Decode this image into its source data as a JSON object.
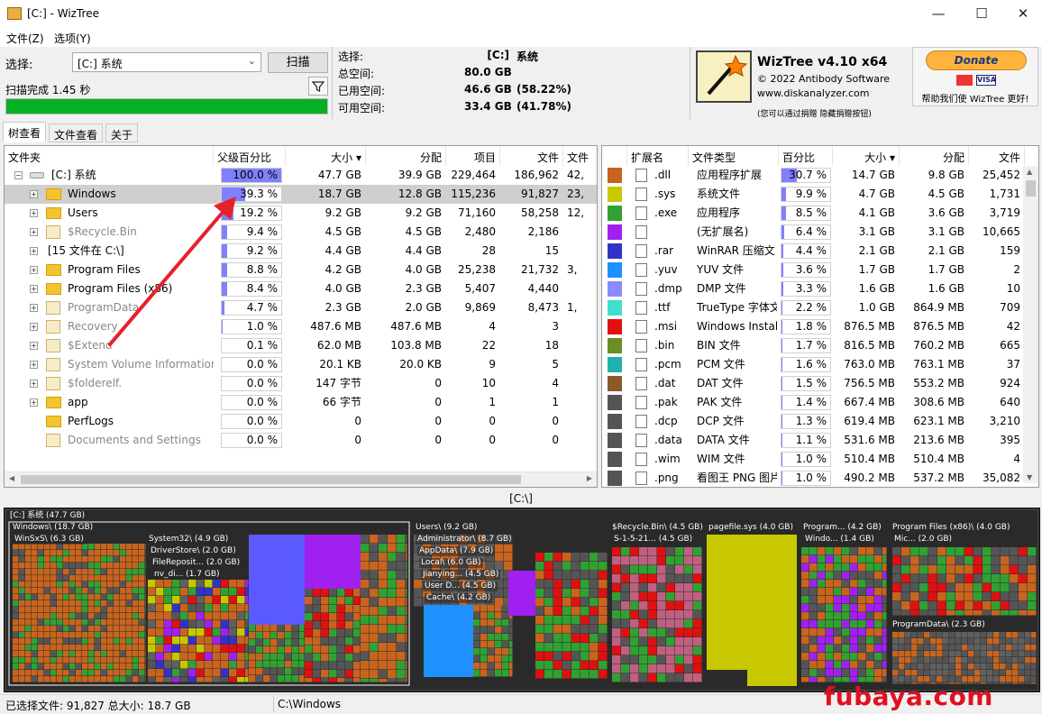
{
  "window": {
    "title": "[C:]  - WizTree",
    "minimize": "—",
    "maximize": "☐",
    "close": "✕"
  },
  "menu": [
    {
      "label": "文件(Z)"
    },
    {
      "label": "选项(Y)"
    }
  ],
  "scan": {
    "select_label": "选择:",
    "drive": "[C:] 系统",
    "scan_button": "扫描",
    "status": "扫描完成 1.45 秒",
    "progress": 1.0
  },
  "info": {
    "rows": [
      {
        "label": "选择:",
        "value": "[C:]",
        "value2": "系统"
      },
      {
        "label": "总空间:",
        "value": "80.0 GB",
        "value2": ""
      },
      {
        "label": "已用空间:",
        "value": "46.6 GB",
        "value2": "(58.22%)"
      },
      {
        "label": "可用空间:",
        "value": "33.4 GB",
        "value2": "(41.78%)"
      }
    ]
  },
  "brand": {
    "name": "WizTree v4.10 x64",
    "copyright": "© 2022 Antibody Software",
    "site": "www.diskanalyzer.com",
    "note": "(您可以通过捐赠 隐藏捐赠按钮)"
  },
  "donate": {
    "button": "Donate",
    "caption": "帮助我们使 WizTree 更好!"
  },
  "tabs": [
    {
      "label": "树查看"
    },
    {
      "label": "文件查看"
    },
    {
      "label": "关于"
    }
  ],
  "tree": {
    "headers": [
      "文件夹",
      "父级百分比",
      "大小 ▾",
      "分配",
      "项目",
      "文件",
      "文件"
    ],
    "rows": [
      {
        "name": "[C:] 系统",
        "pct": "100.0 %",
        "pctv": 1.0,
        "size": "47.7 GB",
        "alloc": "39.9 GB",
        "items": "229,464",
        "files": "186,962",
        "more": "42,",
        "kind": "drive",
        "indent": 0
      },
      {
        "name": "Windows",
        "pct": "39.3 %",
        "pctv": 0.393,
        "size": "18.7 GB",
        "alloc": "12.8 GB",
        "items": "115,236",
        "files": "91,827",
        "more": "23,",
        "kind": "folder",
        "indent": 1,
        "selected": true
      },
      {
        "name": "Users",
        "pct": "19.2 %",
        "pctv": 0.192,
        "size": "9.2 GB",
        "alloc": "9.2 GB",
        "items": "71,160",
        "files": "58,258",
        "more": "12,",
        "kind": "folder",
        "indent": 1
      },
      {
        "name": "$Recycle.Bin",
        "pct": "9.4 %",
        "pctv": 0.094,
        "size": "4.5 GB",
        "alloc": "4.5 GB",
        "items": "2,480",
        "files": "2,186",
        "more": "",
        "kind": "sys",
        "indent": 1
      },
      {
        "name": "[15 文件在 C:\\]",
        "pct": "9.2 %",
        "pctv": 0.092,
        "size": "4.4 GB",
        "alloc": "4.4 GB",
        "items": "28",
        "files": "15",
        "more": "",
        "kind": "none",
        "indent": 1
      },
      {
        "name": "Program Files",
        "pct": "8.8 %",
        "pctv": 0.088,
        "size": "4.2 GB",
        "alloc": "4.0 GB",
        "items": "25,238",
        "files": "21,732",
        "more": "3,",
        "kind": "folder",
        "indent": 1
      },
      {
        "name": "Program Files (x86)",
        "pct": "8.4 %",
        "pctv": 0.084,
        "size": "4.0 GB",
        "alloc": "2.3 GB",
        "items": "5,407",
        "files": "4,440",
        "more": "",
        "kind": "folder",
        "indent": 1
      },
      {
        "name": "ProgramData",
        "pct": "4.7 %",
        "pctv": 0.047,
        "size": "2.3 GB",
        "alloc": "2.0 GB",
        "items": "9,869",
        "files": "8,473",
        "more": "1,",
        "kind": "hidden",
        "indent": 1
      },
      {
        "name": "Recovery",
        "pct": "1.0 %",
        "pctv": 0.01,
        "size": "487.6 MB",
        "alloc": "487.6 MB",
        "items": "4",
        "files": "3",
        "more": "",
        "kind": "sys",
        "indent": 1
      },
      {
        "name": "$Extend",
        "pct": "0.1 %",
        "pctv": 0.001,
        "size": "62.0 MB",
        "alloc": "103.8 MB",
        "items": "22",
        "files": "18",
        "more": "",
        "kind": "sys",
        "indent": 1
      },
      {
        "name": "System Volume Information",
        "pct": "0.0 %",
        "pctv": 0.0,
        "size": "20.1 KB",
        "alloc": "20.0 KB",
        "items": "9",
        "files": "5",
        "more": "",
        "kind": "sys",
        "indent": 1
      },
      {
        "name": "$folderelf.",
        "pct": "0.0 %",
        "pctv": 0.0,
        "size": "147 字节",
        "alloc": "0",
        "items": "10",
        "files": "4",
        "more": "",
        "kind": "sys",
        "indent": 1
      },
      {
        "name": "app",
        "pct": "0.0 %",
        "pctv": 0.0,
        "size": "66 字节",
        "alloc": "0",
        "items": "1",
        "files": "1",
        "more": "",
        "kind": "folder",
        "indent": 1
      },
      {
        "name": "PerfLogs",
        "pct": "0.0 %",
        "pctv": 0.0,
        "size": "0",
        "alloc": "0",
        "items": "0",
        "files": "0",
        "more": "",
        "kind": "folder",
        "indent": 1
      },
      {
        "name": "Documents and Settings",
        "pct": "0.0 %",
        "pctv": 0.0,
        "size": "0",
        "alloc": "0",
        "items": "0",
        "files": "0",
        "more": "",
        "kind": "sys",
        "indent": 1
      }
    ]
  },
  "ext": {
    "headers": [
      "扩展名",
      "文件类型",
      "百分比",
      "大小 ▾",
      "分配",
      "文件"
    ],
    "rows": [
      {
        "color": "#c8641e",
        "ext": ".dll",
        "type": "应用程序扩展",
        "pct": "30.7 %",
        "pctv": 0.307,
        "size": "14.7 GB",
        "alloc": "9.8 GB",
        "files": "25,452"
      },
      {
        "color": "#c8c800",
        "ext": ".sys",
        "type": "系统文件",
        "pct": "9.9 %",
        "pctv": 0.099,
        "size": "4.7 GB",
        "alloc": "4.5 GB",
        "files": "1,731"
      },
      {
        "color": "#32a032",
        "ext": ".exe",
        "type": "应用程序",
        "pct": "8.5 %",
        "pctv": 0.085,
        "size": "4.1 GB",
        "alloc": "3.6 GB",
        "files": "3,719"
      },
      {
        "color": "#a020f0",
        "ext": "",
        "type": "(无扩展名)",
        "pct": "6.4 %",
        "pctv": 0.064,
        "size": "3.1 GB",
        "alloc": "3.1 GB",
        "files": "10,665"
      },
      {
        "color": "#3232c8",
        "ext": ".rar",
        "type": "WinRAR 压缩文",
        "pct": "4.4 %",
        "pctv": 0.044,
        "size": "2.1 GB",
        "alloc": "2.1 GB",
        "files": "159"
      },
      {
        "color": "#1e90ff",
        "ext": ".yuv",
        "type": "YUV 文件",
        "pct": "3.6 %",
        "pctv": 0.036,
        "size": "1.7 GB",
        "alloc": "1.7 GB",
        "files": "2"
      },
      {
        "color": "#8a8aff",
        "ext": ".dmp",
        "type": "DMP 文件",
        "pct": "3.3 %",
        "pctv": 0.033,
        "size": "1.6 GB",
        "alloc": "1.6 GB",
        "files": "10"
      },
      {
        "color": "#40e0d0",
        "ext": ".ttf",
        "type": "TrueType 字体文",
        "pct": "2.2 %",
        "pctv": 0.022,
        "size": "1.0 GB",
        "alloc": "864.9 MB",
        "files": "709"
      },
      {
        "color": "#e01010",
        "ext": ".msi",
        "type": "Windows Installe",
        "pct": "1.8 %",
        "pctv": 0.018,
        "size": "876.5 MB",
        "alloc": "876.5 MB",
        "files": "42"
      },
      {
        "color": "#6b8e23",
        "ext": ".bin",
        "type": "BIN 文件",
        "pct": "1.7 %",
        "pctv": 0.017,
        "size": "816.5 MB",
        "alloc": "760.2 MB",
        "files": "665"
      },
      {
        "color": "#20b2aa",
        "ext": ".pcm",
        "type": "PCM 文件",
        "pct": "1.6 %",
        "pctv": 0.016,
        "size": "763.0 MB",
        "alloc": "763.1 MB",
        "files": "37"
      },
      {
        "color": "#8b5a2b",
        "ext": ".dat",
        "type": "DAT 文件",
        "pct": "1.5 %",
        "pctv": 0.015,
        "size": "756.5 MB",
        "alloc": "553.2 MB",
        "files": "924"
      },
      {
        "color": "#555555",
        "ext": ".pak",
        "type": "PAK 文件",
        "pct": "1.4 %",
        "pctv": 0.014,
        "size": "667.4 MB",
        "alloc": "308.6 MB",
        "files": "640"
      },
      {
        "color": "#555555",
        "ext": ".dcp",
        "type": "DCP 文件",
        "pct": "1.3 %",
        "pctv": 0.013,
        "size": "619.4 MB",
        "alloc": "623.1 MB",
        "files": "3,210"
      },
      {
        "color": "#555555",
        "ext": ".data",
        "type": "DATA 文件",
        "pct": "1.1 %",
        "pctv": 0.011,
        "size": "531.6 MB",
        "alloc": "213.6 MB",
        "files": "395"
      },
      {
        "color": "#555555",
        "ext": ".wim",
        "type": "WIM 文件",
        "pct": "1.0 %",
        "pctv": 0.01,
        "size": "510.4 MB",
        "alloc": "510.4 MB",
        "files": "4"
      },
      {
        "color": "#555555",
        "ext": ".png",
        "type": "看图王 PNG 图片",
        "pct": "1.0 %",
        "pctv": 0.01,
        "size": "490.2 MB",
        "alloc": "537.2 MB",
        "files": "35,082"
      }
    ]
  },
  "treemap": {
    "path": "[C:\\]",
    "labels": {
      "root": "[C:] 系统 (47.7 GB)",
      "windows": "Windows\\ (18.7 GB)",
      "winsxs": "WinSxS\\ (6.3 GB)",
      "system32": "System32\\ (4.9 GB)",
      "driverstore": "DriverStore\\ (2.0 GB)",
      "filerepo": "FileReposit... (2.0 GB)",
      "nvdi": "nv_di... (1.7 GB)",
      "users": "Users\\ (9.2 GB)",
      "admin": "Administrator\\ (8.7 GB)",
      "appdata": "AppData\\ (7.9 GB)",
      "local": "Local\\ (6.0 GB)",
      "jianying": "Jianying... (4.5 GB)",
      "userd": "User D... (4.5 GB)",
      "cache": "Cache\\ (4.2 GB)",
      "recycle": "$Recycle.Bin\\ (4.5 GB)",
      "s15": "S-1-5-21... (4.5 GB)",
      "pagefile": "pagefile.sys (4.0 GB)",
      "progfiles": "Program... (4.2 GB)",
      "windo": "Windo... (1.4 GB)",
      "progx86": "Program Files (x86)\\ (4.0 GB)",
      "mic": "Mic... (2.0 GB)",
      "progdata": "ProgramData\\ (2.3 GB)"
    }
  },
  "status": {
    "selected": "已选择文件: 91,827  总大小: 18.7 GB",
    "path": "C:\\Windows"
  },
  "watermark": "fubaya.com"
}
